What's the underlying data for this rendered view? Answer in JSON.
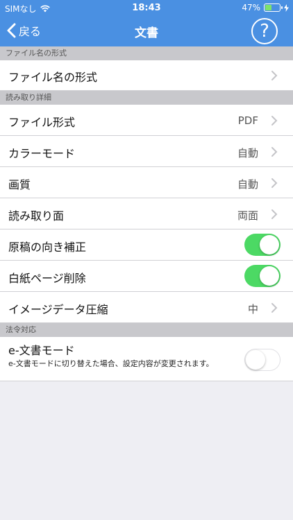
{
  "status": {
    "carrier": "SIMなし",
    "time": "18:43",
    "battery": "47%",
    "battery_level": 0.47,
    "battery_color": "#7ee36b"
  },
  "nav": {
    "back_label": "戻る",
    "title": "文書",
    "help_label": "?"
  },
  "colors": {
    "nav_bar": "#4a90e2",
    "toggle_on": "#4cd964",
    "section_bg": "#c8c8cc",
    "page_bg": "#eeeef3"
  },
  "sections": {
    "filename": {
      "header": "ファイル名の形式",
      "rows": [
        {
          "label": "ファイル名の形式",
          "value": "",
          "accessory": "chevron"
        }
      ]
    },
    "scan": {
      "header": "読み取り詳細",
      "rows": [
        {
          "label": "ファイル形式",
          "value": "PDF",
          "accessory": "chevron"
        },
        {
          "label": "カラーモード",
          "value": "自動",
          "accessory": "chevron"
        },
        {
          "label": "画質",
          "value": "自動",
          "accessory": "chevron"
        },
        {
          "label": "読み取り面",
          "value": "両面",
          "accessory": "chevron"
        },
        {
          "label": "原稿の向き補正",
          "accessory": "toggle",
          "on": true
        },
        {
          "label": "白紙ページ削除",
          "accessory": "toggle",
          "on": true
        },
        {
          "label": "イメージデータ圧縮",
          "value": "中",
          "accessory": "chevron"
        }
      ]
    },
    "legal": {
      "header": "法令対応",
      "rows": [
        {
          "label": "e-文書モード",
          "sublabel": "e-文書モードに切り替えた場合、設定内容が変更されます。",
          "accessory": "toggle",
          "on": false
        }
      ]
    }
  }
}
